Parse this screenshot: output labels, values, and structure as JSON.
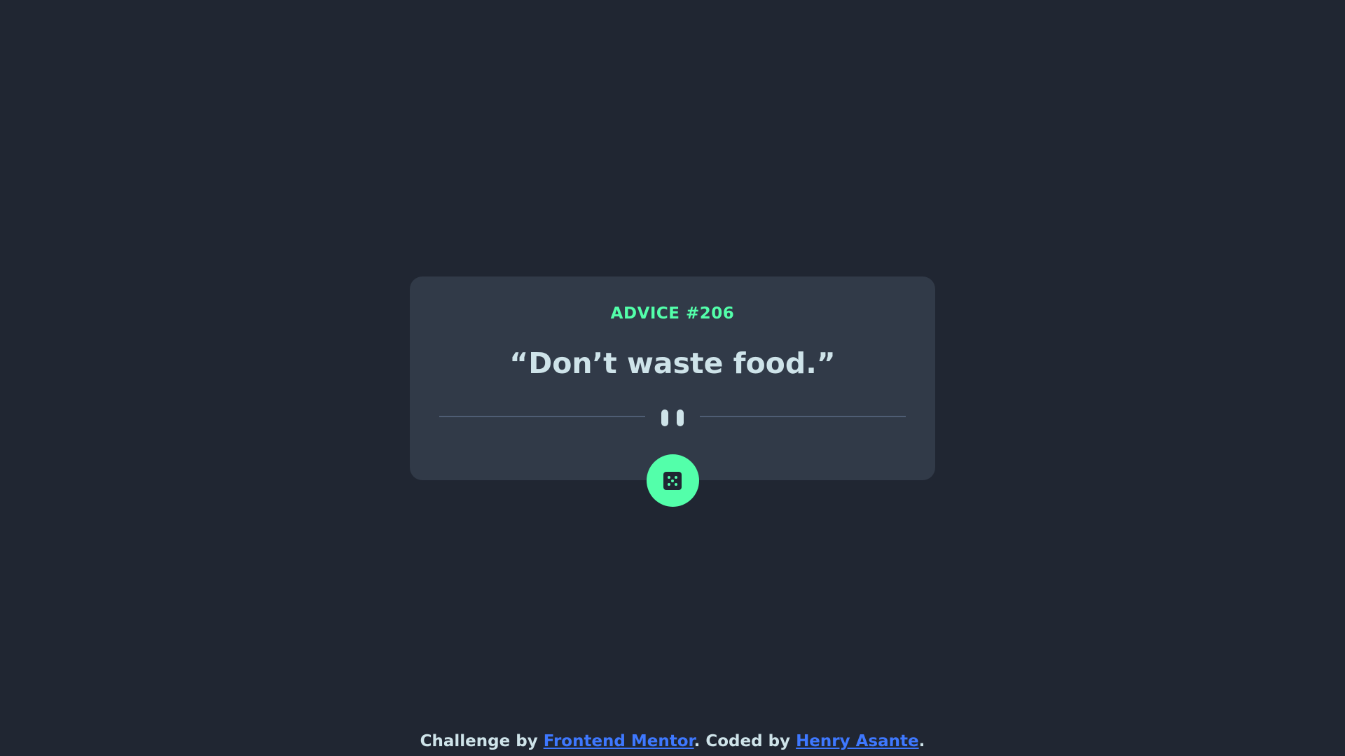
{
  "advice": {
    "label": "ADVICE #206",
    "quote": "“Don’t waste food.”"
  },
  "divider": {
    "icon": "pause-icon"
  },
  "dice": {
    "icon": "dice-icon"
  },
  "footer": {
    "prefix": "Challenge by",
    "link1": "Frontend Mentor",
    "middle": ". Coded by",
    "link2": "Henry Asante",
    "suffix": "."
  },
  "colors": {
    "background": "#202632",
    "card": "#313a48",
    "accent": "#53ffaa",
    "text": "#cee3e9",
    "link": "#3e78ff",
    "divider": "#4f5d74"
  }
}
